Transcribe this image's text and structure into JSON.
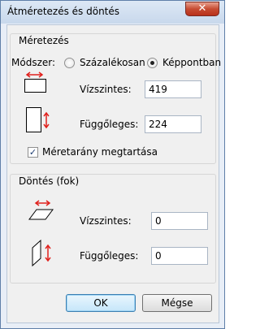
{
  "window": {
    "title": "Átméretezés és döntés",
    "close_glyph": "✕"
  },
  "resize": {
    "group_label": "Méretezés",
    "method_label": "Módszer:",
    "method_options": [
      {
        "label": "Százalékosan",
        "checked": false
      },
      {
        "label": "Képpontban",
        "checked": true
      }
    ],
    "horizontal_label": "Vízszintes:",
    "horizontal_value": "419",
    "vertical_label": "Függőleges:",
    "vertical_value": "224",
    "keep_ratio_label": "Méretarány megtartása",
    "keep_ratio_checked": true
  },
  "skew": {
    "group_label": "Döntés (fok)",
    "horizontal_label": "Vízszintes:",
    "horizontal_value": "0",
    "vertical_label": "Függőleges:",
    "vertical_value": "0"
  },
  "buttons": {
    "ok_label": "OK",
    "cancel_label": "Mégse"
  },
  "colors": {
    "arrow": "#e0201c",
    "close_button": "#c74c32"
  },
  "icons": {
    "resize_horizontal": "resize-horizontal-icon",
    "resize_vertical": "resize-vertical-icon",
    "skew_horizontal": "skew-horizontal-icon",
    "skew_vertical": "skew-vertical-icon"
  }
}
